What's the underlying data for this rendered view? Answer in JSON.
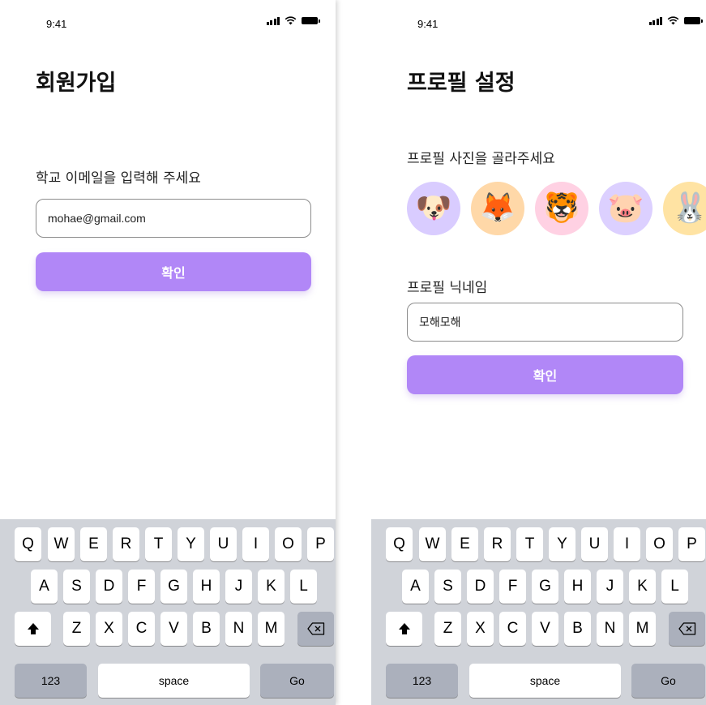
{
  "status_bar": {
    "time": "9:41"
  },
  "signup_screen": {
    "title": "회원가입",
    "email_label": "학교 이메일을 입력해 주세요",
    "email_value": "mohae@gmail.com",
    "confirm_label": "확인"
  },
  "profile_screen": {
    "title": "프로필 설정",
    "photo_label": "프로필 사진을 골라주세요",
    "avatars": [
      {
        "icon": "dog-face-icon",
        "glyph": "🐶",
        "bg": "#d9ccff"
      },
      {
        "icon": "fox-face-icon",
        "glyph": "🦊",
        "bg": "#ffd8a8"
      },
      {
        "icon": "tiger-face-icon",
        "glyph": "🐯",
        "bg": "#ffd1e3"
      },
      {
        "icon": "pig-face-icon",
        "glyph": "🐷",
        "bg": "#dcd0ff"
      },
      {
        "icon": "rabbit-face-icon",
        "glyph": "🐰",
        "bg": "#ffe3a3"
      }
    ],
    "nickname_label": "프로필 닉네임",
    "nickname_value": "모해모해",
    "confirm_label": "확인"
  },
  "keyboard": {
    "row1": [
      "Q",
      "W",
      "E",
      "R",
      "T",
      "Y",
      "U",
      "I",
      "O",
      "P"
    ],
    "row2": [
      "A",
      "S",
      "D",
      "F",
      "G",
      "H",
      "J",
      "K",
      "L"
    ],
    "row3": [
      "Z",
      "X",
      "C",
      "V",
      "B",
      "N",
      "M"
    ],
    "numbers_label": "123",
    "space_label": "space",
    "go_label": "Go"
  },
  "colors": {
    "accent": "#b187f7",
    "keyboard_bg": "#d0d3d9",
    "dark_key": "#abb0bc"
  }
}
